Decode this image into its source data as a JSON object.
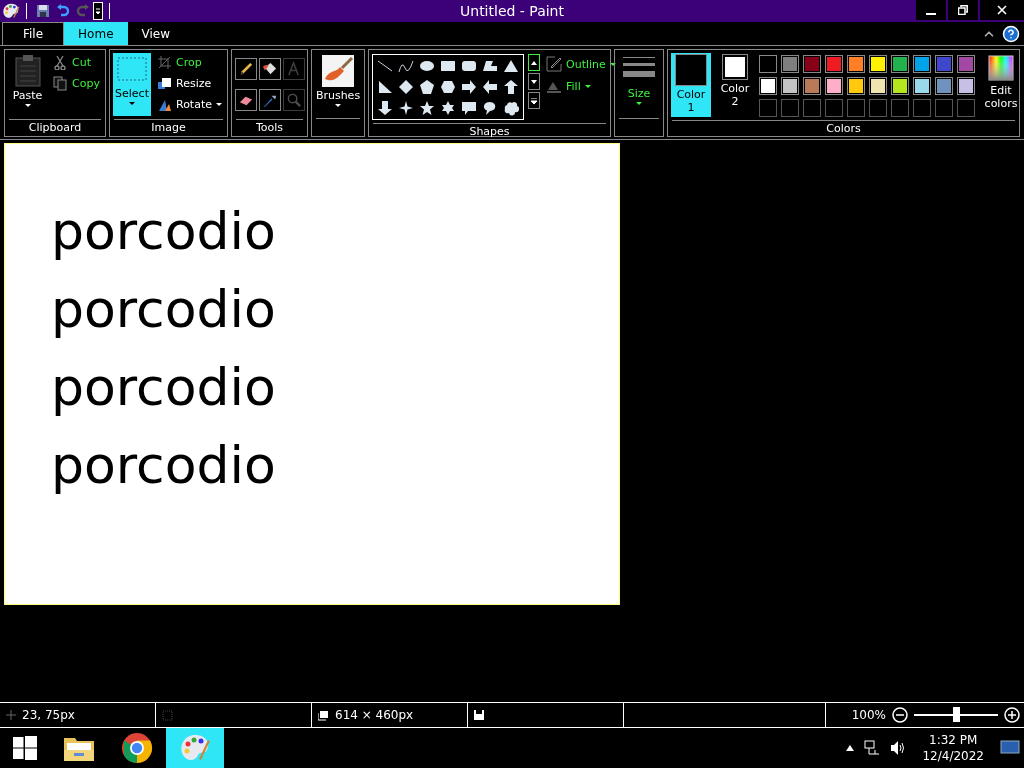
{
  "window": {
    "title": "Untitled - Paint"
  },
  "quick_access": [
    {
      "kind": "save",
      "disabled": false
    },
    {
      "kind": "undo",
      "disabled": false
    },
    {
      "kind": "redo",
      "disabled": true
    }
  ],
  "tabs": [
    {
      "label": "File",
      "selected": false
    },
    {
      "label": "Home",
      "selected": true
    },
    {
      "label": "View",
      "selected": false
    }
  ],
  "clipboard": {
    "label": "Clipboard",
    "paste": "Paste",
    "actions": [
      {
        "kind": "cut",
        "label": "Cut",
        "disabled": true,
        "dropdown": false
      },
      {
        "kind": "copy",
        "label": "Copy",
        "disabled": true,
        "dropdown": false
      }
    ]
  },
  "image": {
    "label": "Image",
    "select": {
      "label": "Select",
      "selected": true
    },
    "actions": [
      {
        "kind": "crop",
        "label": "Crop",
        "disabled": true,
        "dropdown": false
      },
      {
        "kind": "resize",
        "label": "Resize",
        "disabled": false,
        "dropdown": false
      },
      {
        "kind": "rotate",
        "label": "Rotate",
        "disabled": false,
        "dropdown": true
      }
    ]
  },
  "tools": {
    "label": "Tools",
    "items": [
      {
        "kind": "pencil",
        "disabled": false
      },
      {
        "kind": "fill",
        "disabled": false
      },
      {
        "kind": "text",
        "disabled": true
      },
      {
        "kind": "eraser",
        "disabled": false
      },
      {
        "kind": "picker",
        "disabled": false
      },
      {
        "kind": "magnifier",
        "disabled": true
      }
    ]
  },
  "brushes": {
    "label": "Brushes"
  },
  "shapes": {
    "label": "Shapes",
    "outline": {
      "label": "Outline",
      "disabled": true
    },
    "fill": {
      "label": "Fill",
      "disabled": true
    }
  },
  "size": {
    "label": "Size",
    "disabled": true
  },
  "colors": {
    "label": "Colors",
    "slots": [
      {
        "label": "Color 1",
        "color": "#000000",
        "selected": true
      },
      {
        "label": "Color 2",
        "color": "#ffffff",
        "selected": false
      }
    ],
    "palette": [
      {
        "color": "#000000"
      },
      {
        "color": "#7f7f7f"
      },
      {
        "color": "#880015"
      },
      {
        "color": "#ed1c24"
      },
      {
        "color": "#ff7f27"
      },
      {
        "color": "#fff200"
      },
      {
        "color": "#22b14c"
      },
      {
        "color": "#00a2e8"
      },
      {
        "color": "#3f48cc"
      },
      {
        "color": "#a349a4"
      },
      {
        "color": "#ffffff"
      },
      {
        "color": "#c3c3c3"
      },
      {
        "color": "#b97a57"
      },
      {
        "color": "#ffaec9"
      },
      {
        "color": "#ffc90e"
      },
      {
        "color": "#efe4b0"
      },
      {
        "color": "#b5e61d"
      },
      {
        "color": "#99d9ea"
      },
      {
        "color": "#7092be"
      },
      {
        "color": "#c8bfe7"
      }
    ],
    "edit": "Edit colors"
  },
  "canvas": {
    "lines": [
      "porcodio",
      "porcodio",
      "porcodio",
      "porcodio"
    ]
  },
  "status_bar": {
    "position": "23, 75px",
    "size": "614 × 460px",
    "zoom": "100%",
    "zoom_slider": {
      "level": 0.5
    }
  },
  "taskbar": {
    "apps": [
      {
        "kind": "explorer",
        "selected": false
      },
      {
        "kind": "chrome",
        "selected": false
      },
      {
        "kind": "paint",
        "selected": true
      }
    ],
    "time": "1:32 PM",
    "date": "12/4/2022"
  }
}
